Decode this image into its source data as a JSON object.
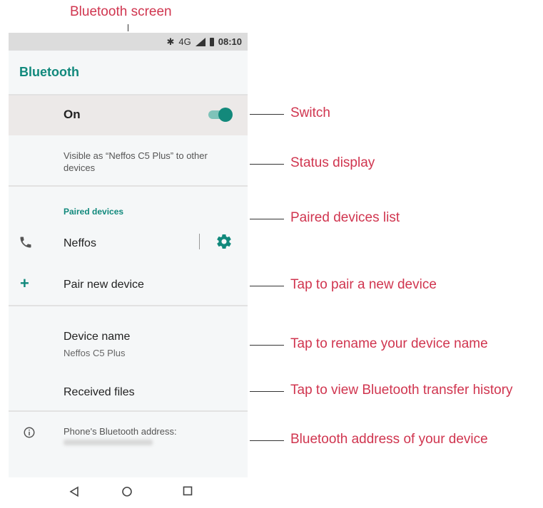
{
  "page_title": "Bluetooth screen",
  "status_bar": {
    "bluetooth_icon": "bluetooth-icon",
    "network": "4G",
    "time": "08:10"
  },
  "app_bar": {
    "title": "Bluetooth"
  },
  "switch_row": {
    "label": "On",
    "state": "on"
  },
  "status_display": {
    "text": "Visible as “Neffos C5 Plus” to other devices"
  },
  "paired": {
    "header": "Paired devices",
    "devices": [
      {
        "name": "Neffos",
        "icon": "phone-icon",
        "settings_icon": "gear-icon"
      }
    ]
  },
  "pair_new": {
    "label": "Pair new device",
    "icon": "plus-icon"
  },
  "device_name": {
    "title": "Device name",
    "value": "Neffos C5 Plus"
  },
  "received_files": {
    "label": "Received files"
  },
  "bt_address": {
    "label": "Phone's Bluetooth address:",
    "icon": "info-icon"
  },
  "nav": {
    "back": "back-icon",
    "home": "home-icon",
    "recents": "recents-icon"
  },
  "callouts": {
    "switch": "Switch",
    "status": "Status display",
    "paired": "Paired devices list",
    "pair_new": "Tap to pair a new device",
    "rename": "Tap to rename your device name",
    "history": "Tap to view Bluetooth transfer history",
    "address": "Bluetooth address of your device"
  },
  "colors": {
    "accent": "#11897c",
    "callout": "#d0354f",
    "toggle_track": "#7fc3b9"
  }
}
